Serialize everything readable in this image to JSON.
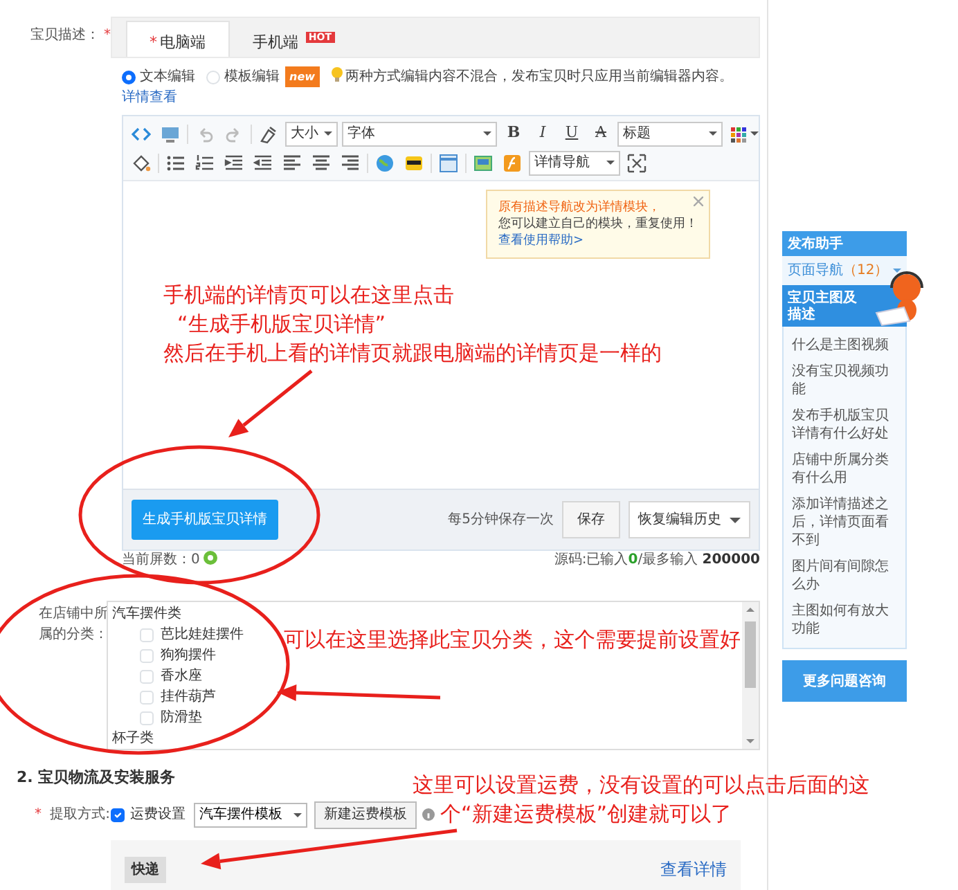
{
  "description_field": {
    "label": "宝贝描述：",
    "required_mark": "*",
    "tabs": [
      {
        "label": "电脑端",
        "required_mark": "*",
        "selected": true
      },
      {
        "label": "手机端",
        "badge": "HOT",
        "selected": false
      }
    ],
    "editor_modes": [
      {
        "label": "文本编辑",
        "selected": true
      },
      {
        "label": "模板编辑",
        "badge": "new",
        "selected": false
      }
    ],
    "tip": "两种方式编辑内容不混合，发布宝贝时只应用当前编辑器内容。",
    "tip_link": "详情查看",
    "toolbar": {
      "size_select": "大小",
      "font_select": "字体",
      "format_buttons": [
        {
          "label": "B",
          "kind": "bold"
        },
        {
          "label": "I",
          "kind": "italic"
        },
        {
          "label": "U",
          "kind": "underline"
        },
        {
          "label": "A",
          "kind": "strike"
        }
      ],
      "heading_select": "标题",
      "nav_select": "详情导航"
    },
    "popup": {
      "highlight": "原有描述导航改为详情模块，",
      "text": "您可以建立自己的模块，重复使用！",
      "link": "查看使用帮助>"
    },
    "generate_button": "生成手机版宝贝详情",
    "autosave_note": "每5分钟保存一次",
    "save_button": "保存",
    "history_dropdown": "恢复编辑历史",
    "screen_count_label": "当前屏数：",
    "screen_count": "0",
    "source_label": "源码:已输入",
    "source_count": "0",
    "source_max_label": "/最多输入",
    "source_max": "200000"
  },
  "category_field": {
    "label": "在店铺中所属的分类：",
    "groups": [
      {
        "name": "汽车摆件类",
        "items": [
          {
            "label": "芭比娃娃摆件",
            "checked": false
          },
          {
            "label": "狗狗摆件",
            "checked": false
          },
          {
            "label": "香水座",
            "checked": false
          },
          {
            "label": "挂件葫芦",
            "checked": false
          },
          {
            "label": "防滑垫",
            "checked": false
          }
        ]
      },
      {
        "name": "杯子类"
      }
    ]
  },
  "logistics_section": {
    "title": "2. 宝贝物流及安装服务",
    "pickup_label": "提取方式:",
    "required_mark": "*",
    "shipping_checkbox": {
      "label": "运费设置",
      "checked": true
    },
    "template_select": "汽车摆件模板",
    "new_template_button": "新建运费模板",
    "method_tag": "快递",
    "details_link": "查看详情"
  },
  "sidebar": {
    "title": "发布助手",
    "nav_label": "页面导航",
    "nav_count": "（12）",
    "section_title": "宝贝主图及描述",
    "questions": [
      "什么是主图视频",
      "没有宝贝视频功能",
      "发布手机版宝贝详情有什么好处",
      "店铺中所属分类有什么用",
      "添加详情描述之后，详情页面看不到",
      "图片间有间隙怎么办",
      "主图如何有放大功能"
    ],
    "more_button": "更多问题咨询"
  },
  "annotations": [
    {
      "lines": [
        "手机端的详情页可以在这里点击",
        "“生成手机版宝贝详情”",
        "然后在手机上看的详情页就跟电脑端的详情页是一样的"
      ]
    },
    {
      "lines": [
        "可以在这里选择此宝贝分类，这个需要提前设置好"
      ]
    },
    {
      "lines": [
        "这里可以设置运费，没有设置的可以点击后面的这",
        "个“新建运费模板”创建就可以了"
      ]
    }
  ]
}
